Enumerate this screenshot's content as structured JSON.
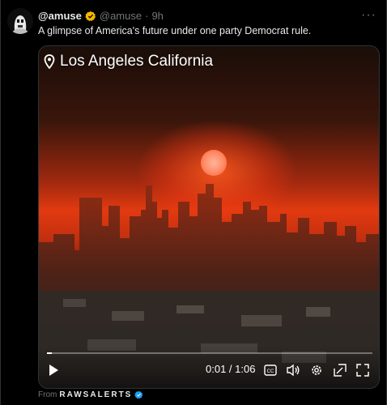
{
  "tweet": {
    "display_name": "@amuse",
    "handle": "@amuse",
    "separator": "·",
    "time": "9h",
    "text": "A glimpse of America's future under one party Democrat rule.",
    "more_label": "···"
  },
  "media": {
    "location_text": "Los Angeles California",
    "time_current": "0:01",
    "time_total": "1:06",
    "time_display": "0:01 / 1:06",
    "progress": 0.015
  },
  "source": {
    "from_label": "From",
    "name": "RAWSALERTS"
  },
  "colors": {
    "verified_gold": "#f5b800",
    "verified_blue": "#1d9bf0",
    "muted": "#71767b"
  },
  "icons": [
    "avatar",
    "verified-gold-icon",
    "more-icon",
    "location-pin-icon",
    "play-icon",
    "captions-icon",
    "volume-icon",
    "settings-icon",
    "pip-icon",
    "fullscreen-icon",
    "verified-blue-icon"
  ]
}
